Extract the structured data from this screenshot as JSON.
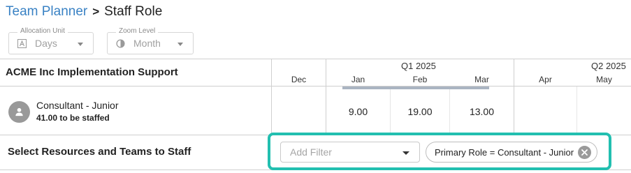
{
  "breadcrumb": {
    "parent": "Team Planner",
    "separator": ">",
    "current": "Staff Role"
  },
  "controls": {
    "allocation_unit": {
      "label": "Allocation Unit",
      "value": "Days"
    },
    "zoom_level": {
      "label": "Zoom Level",
      "value": "Month"
    }
  },
  "project": {
    "title": "ACME Inc Implementation Support"
  },
  "timeline": {
    "quarters": [
      "Q1 2025",
      "Q2 2025"
    ],
    "months": [
      "Dec",
      "Jan",
      "Feb",
      "Mar",
      "Apr",
      "May"
    ]
  },
  "role": {
    "name": "Consultant - Junior",
    "subtitle": "41.00 to be staffed",
    "values": [
      "9.00",
      "19.00",
      "13.00"
    ]
  },
  "staff": {
    "label": "Select Resources and Teams to Staff",
    "filter_placeholder": "Add Filter",
    "chip_text": "Primary Role = Consultant - Junior"
  },
  "colors": {
    "link": "#3a82c4",
    "highlight": "#22bfb0"
  }
}
